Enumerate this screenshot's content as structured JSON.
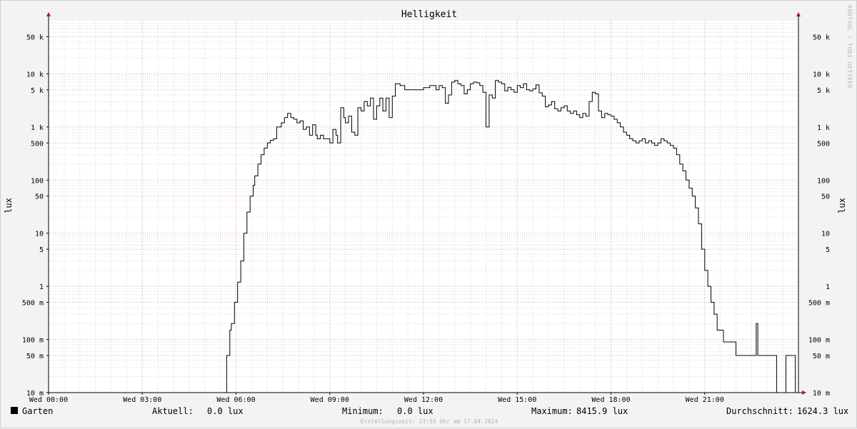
{
  "chart_data": {
    "type": "line",
    "title": "Helligkeit",
    "ylabel": "lux",
    "yscale": "log",
    "ylim": [
      0.01,
      100000
    ],
    "xlim": [
      0,
      24
    ],
    "grid": true,
    "x_ticks": [
      {
        "x": 0,
        "label": "Wed 00:00"
      },
      {
        "x": 3,
        "label": "Wed 03:00"
      },
      {
        "x": 6,
        "label": "Wed 06:00"
      },
      {
        "x": 9,
        "label": "Wed 09:00"
      },
      {
        "x": 12,
        "label": "Wed 12:00"
      },
      {
        "x": 15,
        "label": "Wed 15:00"
      },
      {
        "x": 18,
        "label": "Wed 18:00"
      },
      {
        "x": 21,
        "label": "Wed 21:00"
      }
    ],
    "y_ticks": [
      {
        "v": 0.01,
        "label": "10 m"
      },
      {
        "v": 0.05,
        "label": "50 m"
      },
      {
        "v": 0.1,
        "label": "100 m"
      },
      {
        "v": 0.5,
        "label": "500 m"
      },
      {
        "v": 1,
        "label": "1"
      },
      {
        "v": 5,
        "label": "5"
      },
      {
        "v": 10,
        "label": "10"
      },
      {
        "v": 50,
        "label": "50"
      },
      {
        "v": 100,
        "label": "100"
      },
      {
        "v": 500,
        "label": "500"
      },
      {
        "v": 1000,
        "label": "1 k"
      },
      {
        "v": 5000,
        "label": "5 k"
      },
      {
        "v": 10000,
        "label": "10 k"
      },
      {
        "v": 50000,
        "label": "50 k"
      }
    ],
    "series": [
      {
        "name": "Garten",
        "color": "#000000",
        "x": [
          0,
          5.65,
          5.7,
          5.8,
          5.85,
          5.95,
          6.05,
          6.15,
          6.25,
          6.35,
          6.45,
          6.55,
          6.6,
          6.7,
          6.8,
          6.9,
          7.0,
          7.1,
          7.2,
          7.3,
          7.45,
          7.55,
          7.65,
          7.75,
          7.85,
          7.95,
          8.05,
          8.15,
          8.25,
          8.35,
          8.45,
          8.55,
          8.6,
          8.7,
          8.8,
          8.9,
          9.0,
          9.1,
          9.2,
          9.25,
          9.35,
          9.45,
          9.5,
          9.6,
          9.7,
          9.8,
          9.9,
          10.0,
          10.1,
          10.2,
          10.3,
          10.4,
          10.5,
          10.6,
          10.7,
          10.8,
          10.9,
          11.0,
          11.1,
          11.25,
          11.4,
          11.6,
          11.8,
          12.0,
          12.2,
          12.4,
          12.5,
          12.6,
          12.7,
          12.8,
          12.9,
          13.0,
          13.1,
          13.2,
          13.3,
          13.4,
          13.5,
          13.6,
          13.7,
          13.8,
          13.9,
          14.0,
          14.1,
          14.2,
          14.3,
          14.4,
          14.5,
          14.6,
          14.7,
          14.8,
          14.9,
          15.0,
          15.1,
          15.2,
          15.3,
          15.4,
          15.5,
          15.6,
          15.7,
          15.8,
          15.9,
          16.0,
          16.1,
          16.2,
          16.3,
          16.4,
          16.5,
          16.6,
          16.7,
          16.8,
          16.9,
          17.0,
          17.1,
          17.2,
          17.3,
          17.4,
          17.5,
          17.6,
          17.7,
          17.8,
          17.9,
          18.0,
          18.1,
          18.2,
          18.3,
          18.4,
          18.5,
          18.6,
          18.7,
          18.8,
          18.9,
          19.0,
          19.1,
          19.2,
          19.3,
          19.4,
          19.5,
          19.6,
          19.7,
          19.8,
          19.9,
          20.0,
          20.1,
          20.2,
          20.3,
          20.4,
          20.5,
          20.6,
          20.7,
          20.8,
          20.9,
          21.0,
          21.1,
          21.2,
          21.3,
          21.4,
          21.6,
          22.0,
          22.5,
          22.6,
          22.65,
          22.7,
          23.0,
          23.1,
          23.3,
          23.35,
          23.6,
          23.8,
          23.9
        ],
        "values": [
          0.01,
          0.01,
          0.05,
          0.15,
          0.2,
          0.5,
          1.2,
          3,
          10,
          25,
          50,
          80,
          120,
          200,
          300,
          400,
          500,
          560,
          600,
          1000,
          1200,
          1500,
          1800,
          1500,
          1400,
          1200,
          1300,
          900,
          1000,
          700,
          1100,
          700,
          600,
          700,
          600,
          600,
          500,
          900,
          700,
          500,
          2300,
          1500,
          1200,
          1600,
          800,
          700,
          2300,
          2000,
          3000,
          2500,
          3500,
          1400,
          2500,
          3500,
          2000,
          3500,
          1500,
          3800,
          6500,
          6000,
          5000,
          5000,
          5000,
          5500,
          6000,
          5000,
          6000,
          5500,
          2800,
          4000,
          7000,
          7500,
          6500,
          6000,
          4200,
          5000,
          6500,
          7000,
          6800,
          6000,
          4500,
          1000,
          4000,
          3500,
          7500,
          7000,
          6500,
          4800,
          5600,
          5000,
          4500,
          6000,
          5500,
          6500,
          5000,
          4800,
          5200,
          6200,
          4400,
          3800,
          2400,
          2600,
          3000,
          2200,
          2000,
          2300,
          2500,
          2000,
          1800,
          2000,
          1700,
          1500,
          1800,
          1600,
          3000,
          4500,
          4200,
          2000,
          1500,
          1800,
          1700,
          1600,
          1400,
          1200,
          1000,
          800,
          700,
          600,
          550,
          500,
          550,
          600,
          500,
          550,
          500,
          450,
          500,
          600,
          550,
          500,
          450,
          400,
          300,
          200,
          150,
          100,
          70,
          50,
          30,
          15,
          5,
          2,
          1,
          0.5,
          0.3,
          0.15,
          0.09,
          0.05,
          0.05,
          0.05,
          0.2,
          0.05,
          0.05,
          0.05,
          0.01,
          0.01,
          0.05,
          0.05,
          0.01
        ]
      }
    ]
  },
  "footer": {
    "legend_label": "Garten",
    "current_label": "Aktuell:",
    "current_value": "0.0 lux",
    "min_label": "Minimum:",
    "min_value": "0.0 lux",
    "max_label": "Maximum:",
    "max_value": "8415.9 lux",
    "avg_label": "Durchschnitt:",
    "avg_value": "1624.3 lux",
    "created": "Erstellungszeit: 23:55 Uhr am 17.04.2024"
  },
  "watermark": "RRDTOOL / TOBI OETIKER",
  "colors": {
    "background": "#f3f3f3",
    "plot_background": "#ffffff",
    "minor_grid": "#d8d8d8",
    "major_grid": "#e8a0a0",
    "axis_arrow": "#a02020",
    "line": "#000000"
  }
}
